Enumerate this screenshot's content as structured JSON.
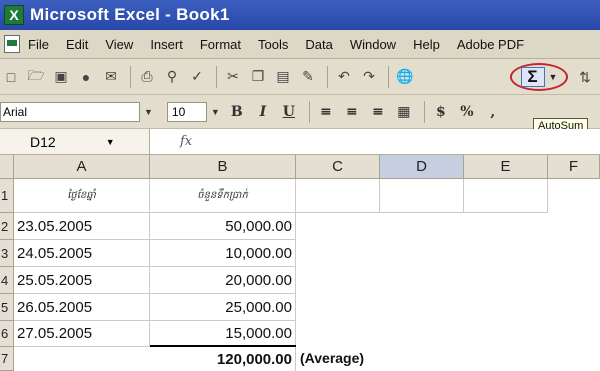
{
  "window": {
    "title": "Microsoft Excel - Book1"
  },
  "menu": [
    "File",
    "Edit",
    "View",
    "Insert",
    "Format",
    "Tools",
    "Data",
    "Window",
    "Help",
    "Adobe PDF"
  ],
  "toolbar": {
    "icons": [
      "new-icon",
      "open-icon",
      "save-icon",
      "permission-icon",
      "email-icon",
      "print-icon",
      "print-preview-icon",
      "spelling-icon",
      "cut-icon",
      "copy-icon",
      "paste-icon",
      "format-painter-icon",
      "undo-icon",
      "redo-icon",
      "hyperlink-icon",
      "autosum-icon",
      "sort-icon"
    ],
    "autosum_symbol": "Σ",
    "highlight_color": "#c8242b"
  },
  "formatting": {
    "font": "Arial",
    "size": "10",
    "bold": "B",
    "italic": "I",
    "underline": "U",
    "currency": "$",
    "percent": "%",
    "comma": ",",
    "tooltip": "AutoSum"
  },
  "formula_bar": {
    "name_box": "D12",
    "fx": "fx",
    "content": ""
  },
  "sheet": {
    "columns": [
      "A",
      "B",
      "C",
      "D",
      "E",
      "F"
    ],
    "rows": [
      "1",
      "2",
      "3",
      "4",
      "5",
      "6",
      "7"
    ],
    "header_a": "ថ្ងៃខែឆ្នាំ",
    "header_b": "ចំនួនទឹកប្រាក់",
    "data": [
      {
        "date": "23.05.2005",
        "amount": "50,000.00"
      },
      {
        "date": "24.05.2005",
        "amount": "10,000.00"
      },
      {
        "date": "25.05.2005",
        "amount": "20,000.00"
      },
      {
        "date": "26.05.2005",
        "amount": "25,000.00"
      },
      {
        "date": "27.05.2005",
        "amount": "15,000.00"
      }
    ],
    "total": "120,000.00",
    "total_note": "(Average)",
    "selected_cell": "D12",
    "active_column": "D"
  }
}
